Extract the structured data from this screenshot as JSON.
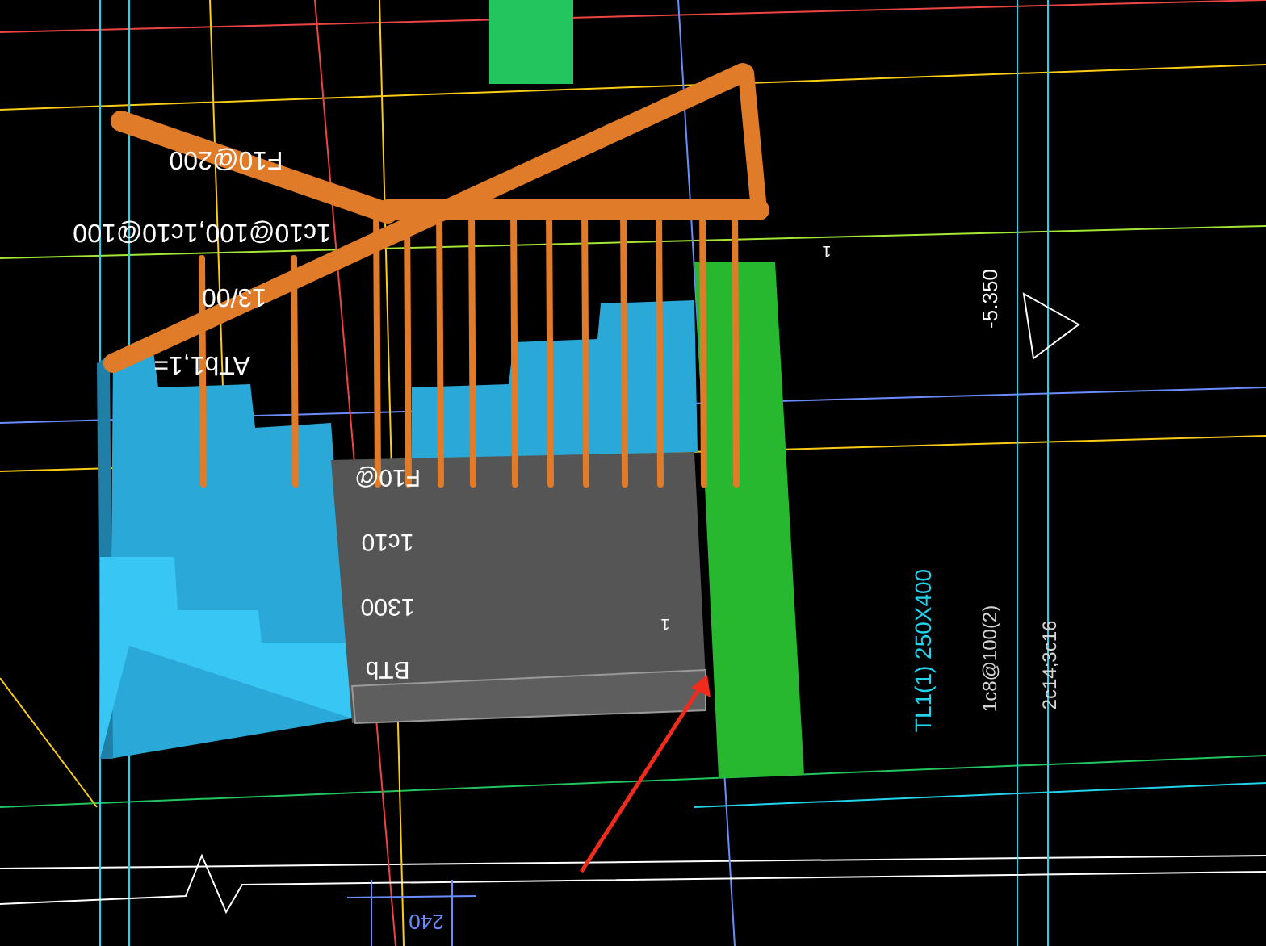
{
  "annotations": [
    {
      "text": "F10@200",
      "kind": "flipped"
    },
    {
      "text": "1c10@100,1c10@100",
      "kind": "flipped"
    },
    {
      "text": "13/00",
      "kind": "flipped"
    },
    {
      "text": "ATb1,1=",
      "kind": "flipped"
    },
    {
      "text": "F10@",
      "kind": "flipped"
    },
    {
      "text": "1c10",
      "kind": "flipped"
    },
    {
      "text": "1300",
      "kind": "flipped"
    },
    {
      "text": "BTb",
      "kind": "flipped"
    },
    {
      "text": "1",
      "kind": "flipped"
    },
    {
      "text": "1",
      "kind": "flipped"
    },
    {
      "text": "240",
      "kind": "flipped"
    },
    {
      "text": "-5.350",
      "kind": "vertical"
    },
    {
      "text": "TL1(1) 250X400",
      "kind": "vertical"
    },
    {
      "text": "1c8@100(2)",
      "kind": "vertical"
    },
    {
      "text": "2c14;3c16",
      "kind": "vertical"
    }
  ]
}
